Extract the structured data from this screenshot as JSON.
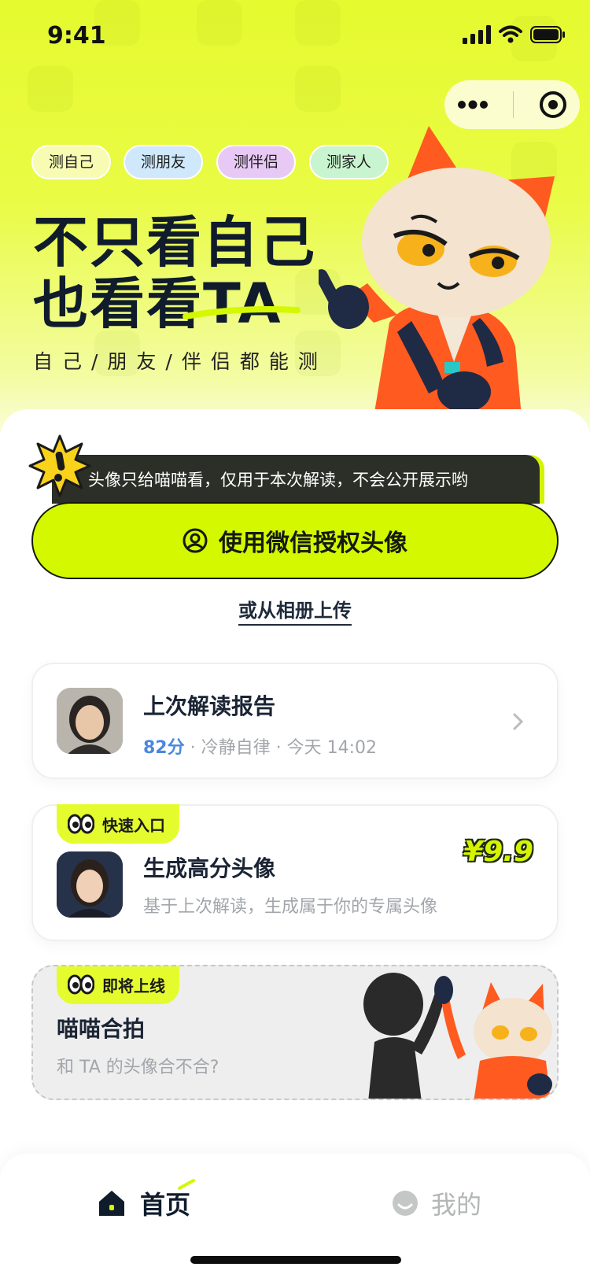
{
  "status_bar": {
    "time": "9:41"
  },
  "tags": [
    {
      "label": "测自己",
      "color": "#f7fcb2"
    },
    {
      "label": "测朋友",
      "color": "#cfe8fb"
    },
    {
      "label": "测伴侣",
      "color": "#e8c9f6"
    },
    {
      "label": "测家人",
      "color": "#c8f4cf"
    }
  ],
  "hero": {
    "headline_line1": "不只看自己",
    "headline_line2": "也看看TA",
    "subline": "自己/朋友/伴侣都能测"
  },
  "privacy_tip": {
    "text": "头像只给喵喵看，仅用于本次解读，不会公开展示哟",
    "icon": "exclamation-burst-icon"
  },
  "main_button": {
    "label": "使用微信授权头像",
    "icon": "user-circle-icon"
  },
  "upload_link": {
    "label": "或从相册上传"
  },
  "last_report": {
    "title": "上次解读报告",
    "score": "82分",
    "detail": "· 冷静自律 · 今天 14:02",
    "chevron_icon": "chevron-right-icon"
  },
  "quick_entry": {
    "badge": "快速入口",
    "title": "生成高分头像",
    "subtitle": "基于上次解读，生成属于你的专属头像",
    "price": "¥9.9"
  },
  "coming_soon": {
    "badge": "即将上线",
    "title": "喵喵合拍",
    "subtitle": "和 TA 的头像合不合?"
  },
  "tabbar": {
    "home_label": "首页",
    "mine_label": "我的",
    "accent": "#d4f800"
  }
}
